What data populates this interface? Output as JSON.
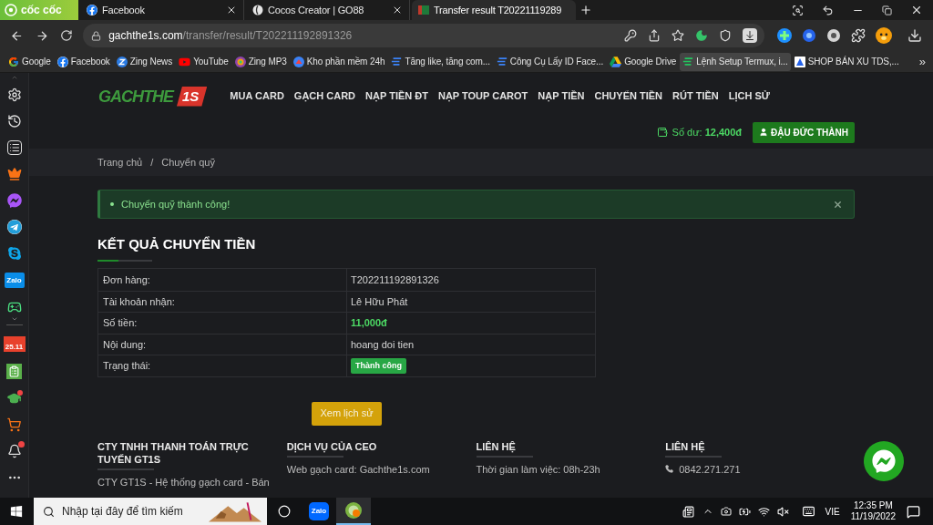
{
  "browser": {
    "brand": "cốc cốc",
    "tabs": [
      {
        "title": "Facebook",
        "selected": false
      },
      {
        "title": "Cocos Creator | GO88",
        "selected": false
      },
      {
        "title": "Transfer result T20221119289",
        "selected": true
      }
    ],
    "address": {
      "host": "gachthe1s.com",
      "path": "/transfer/result/T202211192891326"
    },
    "bookmarks": [
      {
        "label": "Google",
        "hovered": false
      },
      {
        "label": "Facebook",
        "hovered": false
      },
      {
        "label": "Zing News",
        "hovered": false
      },
      {
        "label": "YouTube",
        "hovered": false
      },
      {
        "label": "Zing MP3",
        "hovered": false
      },
      {
        "label": "Kho phần mềm 24h",
        "hovered": false
      },
      {
        "label": "Tăng like, tăng com...",
        "hovered": false
      },
      {
        "label": "Công Cụ Lấy ID Face...",
        "hovered": false
      },
      {
        "label": "Google Drive",
        "hovered": false
      },
      {
        "label": "Lệnh Setup Termux, i...",
        "hovered": true
      },
      {
        "label": "SHOP BÁN XU TDS,...",
        "hovered": false
      }
    ],
    "bookmarks_more": "»"
  },
  "sidebar": {
    "zalo_label": "Zalo",
    "promo_label": "25.11"
  },
  "site": {
    "logo": {
      "word": "GACHTHE",
      "badge": "1S"
    },
    "nav": [
      "MUA CARD",
      "GẠCH CARD",
      "NẠP TIỀN ĐT",
      "NẠP TOUP CAROT",
      "NẠP TIỀN",
      "CHUYỂN TIỀN",
      "RÚT TIỀN",
      "LỊCH SỬ"
    ],
    "balance": {
      "label": "Số dư:",
      "value": "12,400đ"
    },
    "user": "ĐẬU ĐỨC THÀNH",
    "breadcrumb": {
      "items": [
        "Trang chủ",
        "Chuyển quỹ"
      ],
      "separator": "/"
    },
    "alert": {
      "message": "Chuyển quỹ thành công!"
    },
    "heading": "KẾT QUẢ CHUYỂN TIỀN",
    "details": [
      {
        "label": "Đơn hàng:",
        "value": "T202211192891326",
        "kind": "text"
      },
      {
        "label": "Tài khoản nhận:",
        "value": "Lê Hữu Phát",
        "kind": "text"
      },
      {
        "label": "Số tiền:",
        "value": "11,000đ",
        "kind": "amount"
      },
      {
        "label": "Nội dung:",
        "value": "hoang doi tien",
        "kind": "text"
      },
      {
        "label": "Trạng thái:",
        "value": "Thành công",
        "kind": "badge"
      }
    ],
    "history_button": "Xem lịch sử",
    "footer": [
      {
        "heading": "CTY TNHH THANH TOÁN TRỰC TUYẾN GT1S",
        "text": "CTY GT1S - Hệ thống gạch card - Bán",
        "kind": "text"
      },
      {
        "heading": "DỊCH VỤ CỦA CEO",
        "text": "Web gạch card: Gachthe1s.com",
        "kind": "text"
      },
      {
        "heading": "LIÊN HỆ",
        "text": "Thời gian làm việc: 08h-23h",
        "kind": "text"
      },
      {
        "heading": "LIÊN HỆ",
        "text": "0842.271.271",
        "kind": "phone"
      }
    ]
  },
  "taskbar": {
    "search_placeholder": "Nhập tại đây để tìm kiếm",
    "apps": [
      {
        "label": "Zalo",
        "selected": false
      },
      {
        "selected": true
      }
    ],
    "language": "VIE",
    "time": "12:35 PM",
    "date": "11/19/2022"
  }
}
